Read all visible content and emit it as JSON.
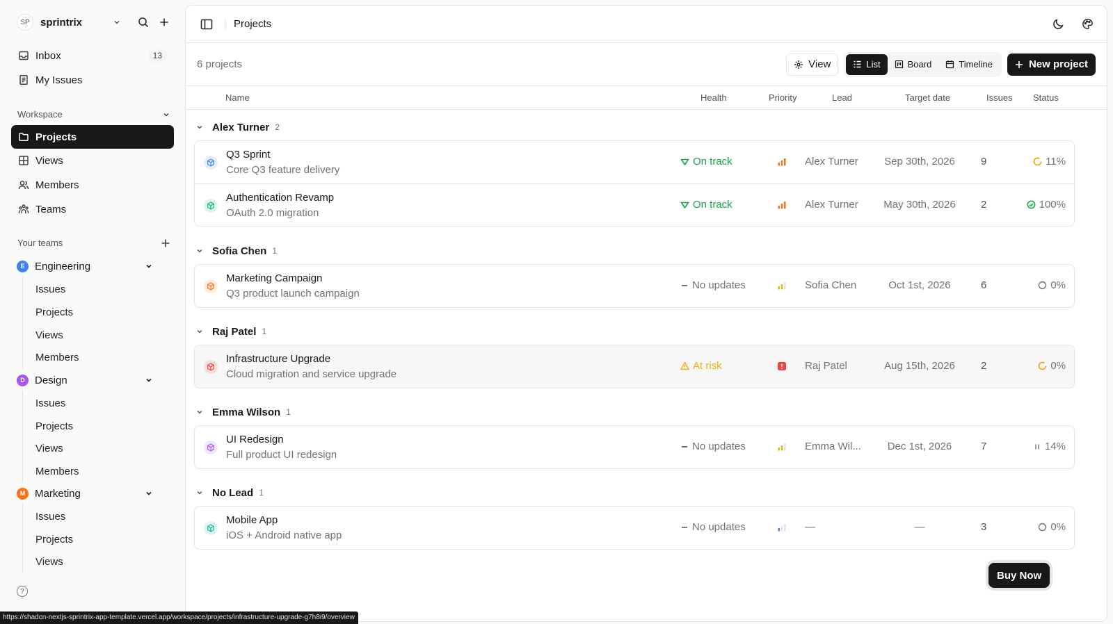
{
  "workspace": {
    "initials": "SP",
    "name": "sprintrix"
  },
  "nav": {
    "inbox": "Inbox",
    "inbox_count": "13",
    "my_issues": "My Issues"
  },
  "workspace_section": {
    "label": "Workspace",
    "projects": "Projects",
    "views": "Views",
    "members": "Members",
    "teams": "Teams"
  },
  "teams_section": {
    "label": "Your teams",
    "teams": [
      {
        "initial": "E",
        "name": "Engineering",
        "color": "#3b82f6",
        "items": [
          "Issues",
          "Projects",
          "Views",
          "Members"
        ]
      },
      {
        "initial": "D",
        "name": "Design",
        "color": "#a855f7",
        "items": [
          "Issues",
          "Projects",
          "Views",
          "Members"
        ]
      },
      {
        "initial": "M",
        "name": "Marketing",
        "color": "#f97316",
        "items": [
          "Issues",
          "Projects",
          "Views"
        ]
      }
    ]
  },
  "status_url": "https://shadcn-nextjs-sprintrix-app-template.vercel.app/workspace/projects/infrastructure-upgrade-g7h8i9/overview",
  "header": {
    "title": "Projects"
  },
  "toolbar": {
    "count": "6 projects",
    "view": "View",
    "list": "List",
    "board": "Board",
    "timeline": "Timeline",
    "new_project": "New project"
  },
  "columns": {
    "name": "Name",
    "health": "Health",
    "priority": "Priority",
    "lead": "Lead",
    "target_date": "Target date",
    "issues": "Issues",
    "status": "Status"
  },
  "groups": [
    {
      "name": "Alex Turner",
      "count": "2",
      "projects": [
        {
          "name": "Q3 Sprint",
          "desc": "Core Q3 feature delivery",
          "icon_color": "#3b82f6",
          "health": "On track",
          "health_kind": "on-track",
          "priority": "high",
          "lead": "Alex Turner",
          "date": "Sep 30th, 2026",
          "issues": "9",
          "status": "11%",
          "status_kind": "progress"
        },
        {
          "name": "Authentication Revamp",
          "desc": "OAuth 2.0 migration",
          "icon_color": "#10b981",
          "health": "On track",
          "health_kind": "on-track",
          "priority": "high",
          "lead": "Alex Turner",
          "date": "May 30th, 2026",
          "issues": "2",
          "status": "100%",
          "status_kind": "done"
        }
      ]
    },
    {
      "name": "Sofia Chen",
      "count": "1",
      "projects": [
        {
          "name": "Marketing Campaign",
          "desc": "Q3 product launch campaign",
          "icon_color": "#f97316",
          "health": "No updates",
          "health_kind": "none",
          "priority": "medium",
          "lead": "Sofia Chen",
          "date": "Oct 1st, 2026",
          "issues": "6",
          "status": "0%",
          "status_kind": "todo"
        }
      ]
    },
    {
      "name": "Raj Patel",
      "count": "1",
      "projects": [
        {
          "name": "Infrastructure Upgrade",
          "desc": "Cloud migration and service upgrade",
          "icon_color": "#ef4444",
          "health": "At risk",
          "health_kind": "at-risk",
          "priority": "urgent",
          "lead": "Raj Patel",
          "date": "Aug 15th, 2026",
          "issues": "2",
          "status": "0%",
          "status_kind": "progress"
        }
      ]
    },
    {
      "name": "Emma Wilson",
      "count": "1",
      "projects": [
        {
          "name": "UI Redesign",
          "desc": "Full product UI redesign",
          "icon_color": "#a855f7",
          "health": "No updates",
          "health_kind": "none",
          "priority": "medium",
          "lead": "Emma Wil...",
          "date": "Dec 1st, 2026",
          "issues": "7",
          "status": "14%",
          "status_kind": "paused"
        }
      ]
    },
    {
      "name": "No Lead",
      "count": "1",
      "projects": [
        {
          "name": "Mobile App",
          "desc": "iOS + Android native app",
          "icon_color": "#14b8a6",
          "health": "No updates",
          "health_kind": "none",
          "priority": "low",
          "lead": "—",
          "date": "—",
          "issues": "3",
          "status": "0%",
          "status_kind": "todo"
        }
      ]
    }
  ],
  "buy_now": "Buy Now",
  "colors": {
    "accent": "#18181b",
    "on_track": "#16a34a",
    "at_risk": "#eab308",
    "done": "#16a34a"
  }
}
